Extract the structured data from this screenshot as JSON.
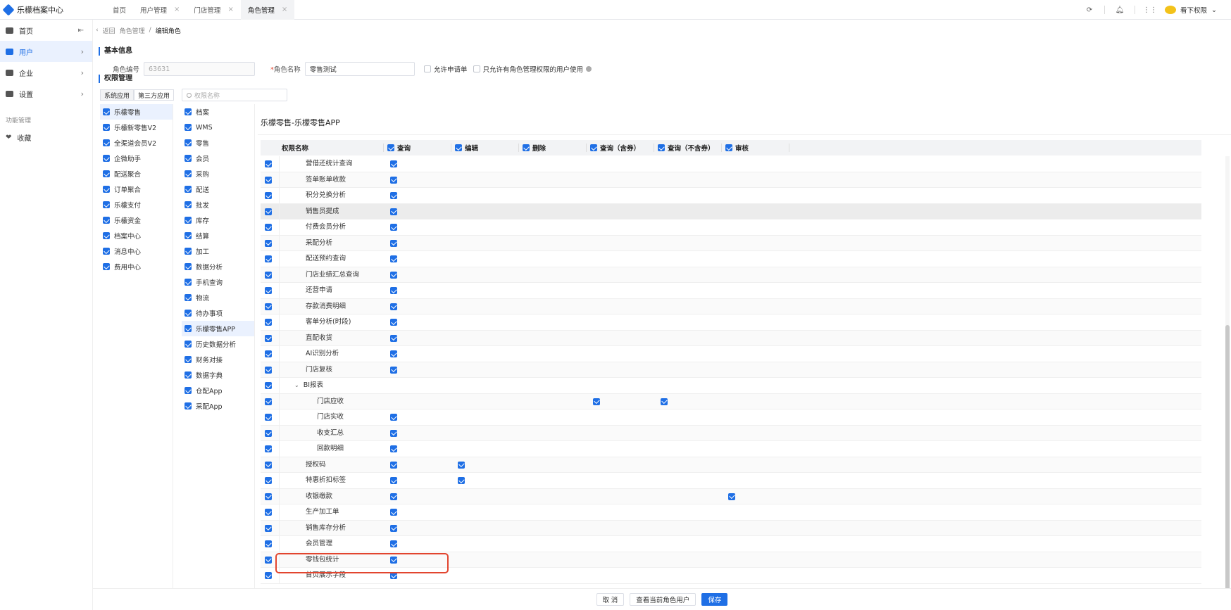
{
  "app": {
    "title": "乐檬档案中心"
  },
  "tabs": [
    {
      "label": "首页",
      "closable": false
    },
    {
      "label": "用户管理",
      "closable": true
    },
    {
      "label": "门店管理",
      "closable": true
    },
    {
      "label": "角色管理",
      "closable": true,
      "active": true
    }
  ],
  "topbar": {
    "user_name": "看下权限"
  },
  "sidebar": {
    "items": [
      {
        "label": "首页",
        "icon": "home-icon"
      },
      {
        "label": "用户",
        "icon": "user-icon",
        "active": true
      },
      {
        "label": "企业",
        "icon": "building-icon"
      },
      {
        "label": "设置",
        "icon": "gear-icon"
      }
    ],
    "section_label": "功能管理",
    "favorites_label": "收藏"
  },
  "breadcrumb": {
    "back": "返回",
    "parent": "角色管理",
    "current": "编辑角色"
  },
  "basic_info": {
    "title": "基本信息",
    "role_no_label": "角色编号",
    "role_no_value": "63631",
    "role_name_label": "角色名称",
    "role_name_value": "零售测试",
    "allow_request_label": "允许申请单",
    "only_role_mgmt_label": "只允许有角色管理权限的用户使用"
  },
  "permission": {
    "title": "权限管理",
    "seg_system": "系统应用",
    "seg_third": "第三方应用",
    "search_placeholder": "权限名称",
    "apps": [
      "乐檬零售",
      "乐檬新零售V2",
      "全渠道会员V2",
      "企微助手",
      "配送聚合",
      "订单聚合",
      "乐檬支付",
      "乐檬资金",
      "档案中心",
      "消息中心",
      "费用中心"
    ],
    "modules": [
      "档案",
      "WMS",
      "零售",
      "会员",
      "采购",
      "配送",
      "批发",
      "库存",
      "结算",
      "加工",
      "数据分析",
      "手机查询",
      "物流",
      "待办事项",
      "乐檬零售APP",
      "历史数据分析",
      "财务对接",
      "数据字典",
      "仓配App",
      "采配App"
    ],
    "pane_title": "乐檬零售-乐檬零售APP",
    "columns": {
      "name": "权限名称",
      "query": "查询",
      "edit": "编辑",
      "delete": "删除",
      "query_incl": "查询（含券）",
      "query_excl": "查询（不含券）",
      "audit": "审核"
    },
    "rows": [
      {
        "name": "营借还统计查询",
        "indent": 1,
        "q": true
      },
      {
        "name": "签单账单收款",
        "indent": 1,
        "q": true
      },
      {
        "name": "积分兑换分析",
        "indent": 1,
        "q": true
      },
      {
        "name": "销售员提成",
        "indent": 1,
        "q": true,
        "hover": true
      },
      {
        "name": "付费会员分析",
        "indent": 1,
        "q": true
      },
      {
        "name": "采配分析",
        "indent": 1,
        "q": true
      },
      {
        "name": "配送预约查询",
        "indent": 1,
        "q": true
      },
      {
        "name": "门店业绩汇总查询",
        "indent": 1,
        "q": true
      },
      {
        "name": "还营申请",
        "indent": 1,
        "q": true
      },
      {
        "name": "存款消费明细",
        "indent": 1,
        "q": true
      },
      {
        "name": "客单分析(时段)",
        "indent": 1,
        "q": true
      },
      {
        "name": "直配收货",
        "indent": 1,
        "q": true
      },
      {
        "name": "AI识别分析",
        "indent": 1,
        "q": true
      },
      {
        "name": "门店复核",
        "indent": 1,
        "q": true
      },
      {
        "name": "BI报表",
        "indent": 1,
        "group": true
      },
      {
        "name": "门店应收",
        "indent": 2,
        "qi": true,
        "qe": true
      },
      {
        "name": "门店实收",
        "indent": 2,
        "q": true
      },
      {
        "name": "收支汇总",
        "indent": 2,
        "q": true
      },
      {
        "name": "回款明细",
        "indent": 2,
        "q": true
      },
      {
        "name": "授权码",
        "indent": 1,
        "q": true,
        "e": true
      },
      {
        "name": "特惠折扣标签",
        "indent": 1,
        "q": true,
        "e": true
      },
      {
        "name": "收银缴款",
        "indent": 1,
        "q": true,
        "a": true
      },
      {
        "name": "生产加工单",
        "indent": 1,
        "q": true
      },
      {
        "name": "销售库存分析",
        "indent": 1,
        "q": true
      },
      {
        "name": "会员管理",
        "indent": 1,
        "q": true
      },
      {
        "name": "零钱包统计",
        "indent": 1,
        "q": true,
        "highlighted": true
      },
      {
        "name": "首页展示字段",
        "indent": 1,
        "q": true
      }
    ]
  },
  "footer": {
    "cancel": "取 消",
    "view_users": "查看当前角色用户",
    "save": "保存"
  },
  "colors": {
    "primary": "#1f6fe5",
    "highlight": "#e2452f"
  }
}
